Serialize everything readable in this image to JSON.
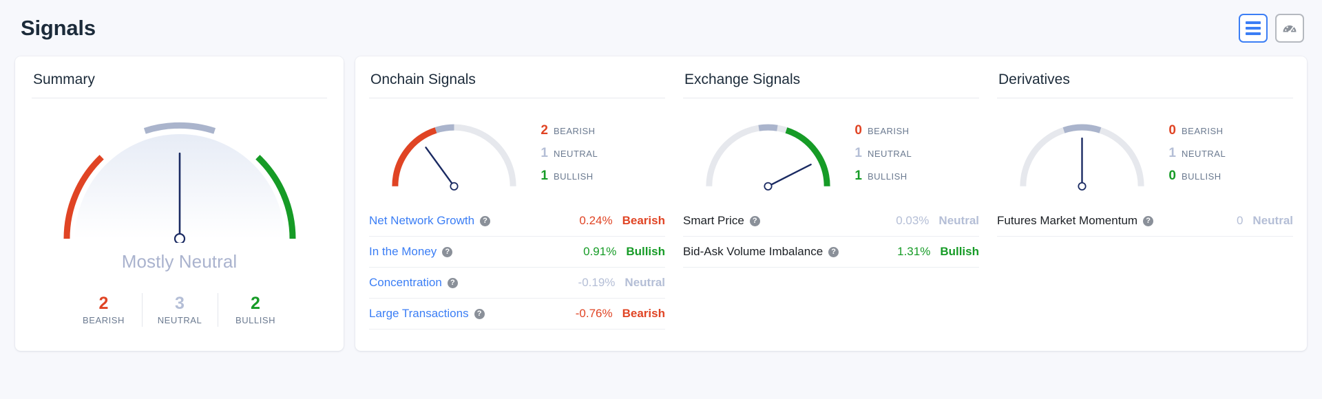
{
  "header": {
    "title": "Signals",
    "toggles": [
      {
        "name": "list-view",
        "icon": "list-icon",
        "active": true
      },
      {
        "name": "gauge-view",
        "icon": "gauge-icon",
        "active": false
      }
    ]
  },
  "colors": {
    "bearish": "#e04424",
    "neutral": "#b4bed6",
    "bullish": "#169b26",
    "link": "#3b7ef5",
    "needle": "#1a2a62",
    "track": "#e6e8ed"
  },
  "summary": {
    "title": "Summary",
    "verdict": "Mostly Neutral",
    "gauge": {
      "bearish_deg": 72,
      "neutral_deg": 36,
      "bullish_deg": 72,
      "needle_deg": 90
    },
    "stats": [
      {
        "count": "2",
        "label": "BEARISH",
        "tone": "bearish"
      },
      {
        "count": "3",
        "label": "NEUTRAL",
        "tone": "neutral"
      },
      {
        "count": "2",
        "label": "BULLISH",
        "tone": "bullish"
      }
    ]
  },
  "panels": [
    {
      "title": "Onchain Signals",
      "links": true,
      "gauge": {
        "bearish_deg": 72,
        "neutral_deg": 18,
        "bullish_deg": 0,
        "needle_deg": 126
      },
      "counts": [
        {
          "n": "2",
          "label": "BEARISH",
          "tone": "bearish"
        },
        {
          "n": "1",
          "label": "NEUTRAL",
          "tone": "neutral"
        },
        {
          "n": "1",
          "label": "BULLISH",
          "tone": "bullish"
        }
      ],
      "rows": [
        {
          "name": "Net Network Growth",
          "value": "0.24%",
          "verdict": "Bearish",
          "tone": "bearish"
        },
        {
          "name": "In the Money",
          "value": "0.91%",
          "verdict": "Bullish",
          "tone": "bullish"
        },
        {
          "name": "Concentration",
          "value": "-0.19%",
          "verdict": "Neutral",
          "tone": "neutral"
        },
        {
          "name": "Large Transactions",
          "value": "-0.76%",
          "verdict": "Bearish",
          "tone": "bearish"
        }
      ]
    },
    {
      "title": "Exchange Signals",
      "links": false,
      "gauge": {
        "bearish_deg": 0,
        "neutral_deg": 18,
        "bullish_deg": 72,
        "needle_deg": 27
      },
      "counts": [
        {
          "n": "0",
          "label": "BEARISH",
          "tone": "bearish"
        },
        {
          "n": "1",
          "label": "NEUTRAL",
          "tone": "neutral"
        },
        {
          "n": "1",
          "label": "BULLISH",
          "tone": "bullish"
        }
      ],
      "rows": [
        {
          "name": "Smart Price",
          "value": "0.03%",
          "verdict": "Neutral",
          "tone": "neutral"
        },
        {
          "name": "Bid-Ask Volume Imbalance",
          "value": "1.31%",
          "verdict": "Bullish",
          "tone": "bullish"
        }
      ]
    },
    {
      "title": "Derivatives",
      "links": false,
      "gauge": {
        "bearish_deg": 0,
        "neutral_deg": 36,
        "bullish_deg": 0,
        "needle_deg": 90
      },
      "counts": [
        {
          "n": "0",
          "label": "BEARISH",
          "tone": "bearish"
        },
        {
          "n": "1",
          "label": "NEUTRAL",
          "tone": "neutral"
        },
        {
          "n": "0",
          "label": "BULLISH",
          "tone": "bullish"
        }
      ],
      "rows": [
        {
          "name": "Futures Market Momentum",
          "value": "0",
          "verdict": "Neutral",
          "tone": "neutral"
        }
      ]
    }
  ]
}
